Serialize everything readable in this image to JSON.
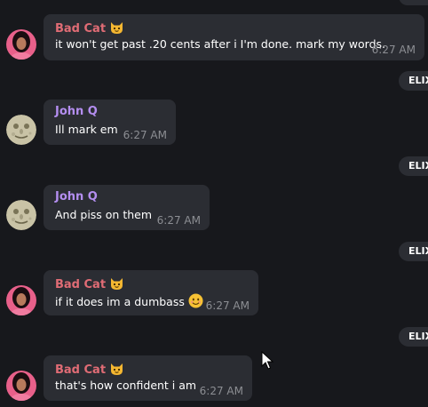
{
  "messages": [
    {
      "sender": "Bad Cat",
      "sender_color": "#e06c75",
      "text": "it won't get past .20 cents after i I'm done. mark my words.",
      "time": "6:27 AM",
      "avatar": "woman-avatar-icon",
      "badge": "cat-face-emoji-icon"
    },
    {
      "sender": "John Q",
      "sender_color": "#b48ef0",
      "text": "Ill mark em",
      "time": "6:27 AM",
      "avatar": "moon-face-avatar-icon"
    },
    {
      "sender": "John Q",
      "sender_color": "#b48ef0",
      "text": "And piss on them",
      "time": "6:27 AM",
      "avatar": "moon-face-avatar-icon"
    },
    {
      "sender": "Bad Cat",
      "sender_color": "#e06c75",
      "text": "if it does im a dumbass",
      "emoji": "smiling-face-emoji-icon",
      "time": "6:27 AM",
      "avatar": "woman-avatar-icon",
      "badge": "cat-face-emoji-icon"
    },
    {
      "sender": "Bad Cat",
      "sender_color": "#e06c75",
      "text": "that's how confident i am",
      "time": "6:27 AM",
      "avatar": "woman-avatar-icon",
      "badge": "cat-face-emoji-icon"
    }
  ],
  "sidebar_pills": [
    {
      "label": "ELIX"
    },
    {
      "label": "ELIX"
    },
    {
      "label": "ELIX"
    },
    {
      "label": "ELIX"
    }
  ],
  "colors": {
    "background": "#17181c",
    "bubble": "#2b2d33",
    "timestamp": "#8c8e93",
    "text": "#ffffff"
  }
}
